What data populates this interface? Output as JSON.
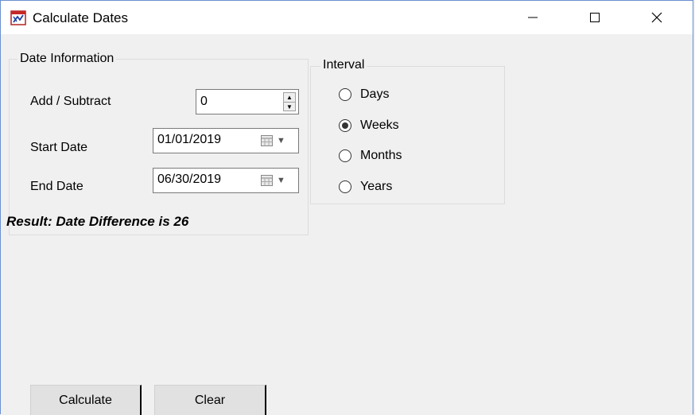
{
  "window": {
    "title": "Calculate Dates",
    "icon": "calendar-app-icon"
  },
  "titlebar_buttons": {
    "minimize": "minimize-icon",
    "maximize": "maximize-icon",
    "close": "close-icon"
  },
  "date_info": {
    "legend": "Date Information",
    "add_subtract_label": "Add / Subtract",
    "add_subtract_value": "0",
    "start_date_label": "Start Date",
    "start_date_value": "01/01/2019",
    "end_date_label": "End Date",
    "end_date_value": "06/30/2019"
  },
  "interval": {
    "legend": "Interval",
    "options": [
      {
        "label": "Days",
        "checked": false
      },
      {
        "label": "Weeks",
        "checked": true
      },
      {
        "label": "Months",
        "checked": false
      },
      {
        "label": "Years",
        "checked": false
      }
    ]
  },
  "result_text": "Result: Date Difference is 26",
  "buttons": {
    "calculate": "Calculate",
    "clear": "Clear"
  }
}
